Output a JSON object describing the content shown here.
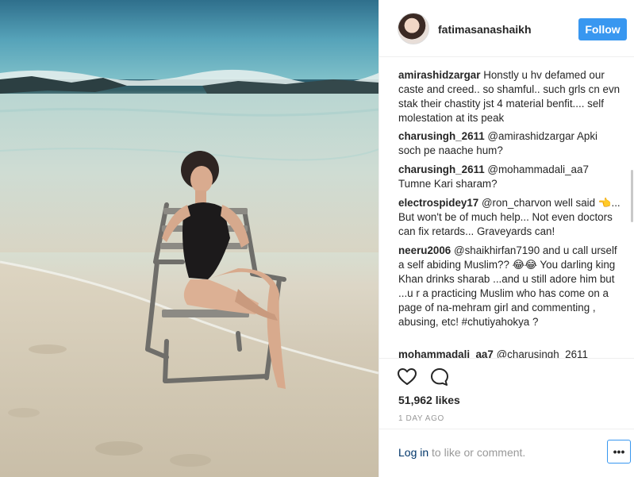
{
  "post": {
    "username": "fatimasanashaikh",
    "follow_label": "Follow",
    "likes": "51,962 likes",
    "time_ago": "1 DAY AGO",
    "login_link": "Log in",
    "login_rest": " to like or comment.",
    "more_label": "•••"
  },
  "comments": {
    "cut_top": "····· ··· · ···· ····",
    "items": [
      {
        "user": "amirashidzargar",
        "text": "Honstly u hv defamed our caste and creed.. so shamful.. such grls cn evn stak their chastity jst 4 material benfit.... self molestation at its peak"
      },
      {
        "user": "charusingh_2611",
        "text": "@amirashidzargar Apki soch pe naache hum?"
      },
      {
        "user": "charusingh_2611",
        "text": "@mohammadali_aa7 Tumne Kari sharam?"
      },
      {
        "user": "electrospidey17",
        "text": "@ron_charvon well said 👈... But won't be of much help... Not even doctors can fix retards... Graveyards can!"
      },
      {
        "user": "neeru2006",
        "text": "@shaikhirfan7190 and u call urself a self abiding Muslim?? 😂😂 You darling king Khan drinks sharab ...and u still adore him but ...u r a practicing Muslim who has come on a page of na-mehram girl and commenting , abusing, etc! #chutiyahokya ?"
      },
      {
        "user": "mohammadali_aa7",
        "text": "@charusingh_2611"
      }
    ]
  },
  "icons": {
    "heart": "heart-icon",
    "comment": "comment-bubble-icon",
    "avatar": "avatar"
  },
  "colors": {
    "follow_button": "#3897f0",
    "link": "#003569",
    "muted": "#999999"
  }
}
